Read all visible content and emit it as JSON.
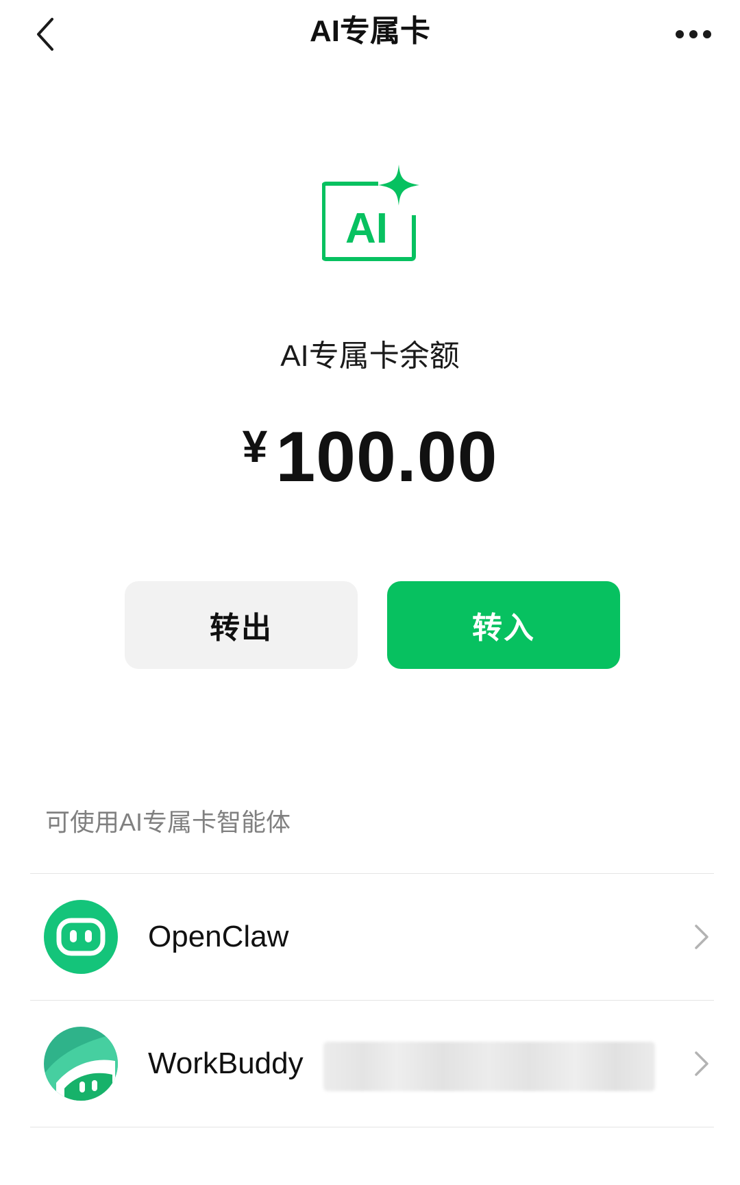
{
  "nav": {
    "title": "AI专属卡",
    "back_icon": "chevron-left-icon",
    "more_icon": "more-horizontal-icon"
  },
  "card": {
    "logo_icon": "ai-sparkle-icon",
    "logo_text": "AI",
    "balance_label": "AI专属卡余额",
    "currency": "¥",
    "balance": "100.00"
  },
  "actions": {
    "transfer_out": "转出",
    "transfer_in": "转入"
  },
  "agents": {
    "section_title": "可使用AI专属卡智能体",
    "items": [
      {
        "name": "OpenClaw",
        "icon": "openclaw-avatar-icon"
      },
      {
        "name": "WorkBuddy",
        "icon": "workbuddy-avatar-icon"
      }
    ]
  },
  "colors": {
    "accent": "#07c160",
    "secondary_button": "#f2f2f2",
    "muted_text": "#808080"
  }
}
